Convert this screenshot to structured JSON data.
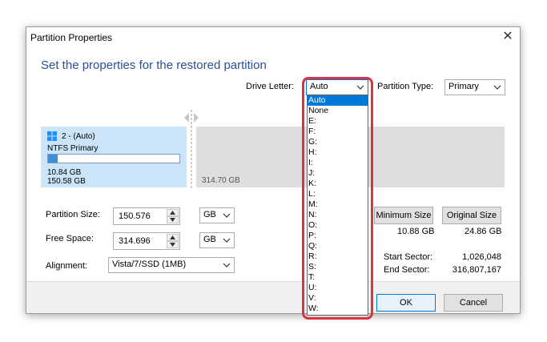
{
  "dialog": {
    "title": "Partition Properties",
    "heading": "Set the properties for the restored partition"
  },
  "drive_letter": {
    "label": "Drive Letter:",
    "value": "Auto"
  },
  "partition_type": {
    "label": "Partition Type:",
    "value": "Primary"
  },
  "partition_block": {
    "name": "2 - (Auto)",
    "fs": "NTFS Primary",
    "used": "10.84 GB",
    "total": "150.58 GB",
    "used_fraction": 0.072,
    "free_label": "314.70 GB"
  },
  "partition_size": {
    "label": "Partition Size:",
    "value": "150.576",
    "unit": "GB"
  },
  "free_space": {
    "label": "Free Space:",
    "value": "314.696",
    "unit": "GB"
  },
  "alignment": {
    "label": "Alignment:",
    "value": "Vista/7/SSD (1MB)"
  },
  "sizes": {
    "min_button": "Minimum Size",
    "orig_button": "Original Size",
    "min_value": "10.88 GB",
    "orig_value": "24.86 GB"
  },
  "sectors": {
    "start_label": "Start Sector:",
    "start_value": "1,026,048",
    "end_label": "End Sector:",
    "end_value": "316,807,167"
  },
  "buttons": {
    "ok": "OK",
    "cancel": "Cancel"
  },
  "dropdown_items": [
    "Auto",
    "None",
    "E:",
    "F:",
    "G:",
    "H:",
    "I:",
    "J:",
    "K:",
    "L:",
    "M:",
    "N:",
    "O:",
    "P:",
    "Q:",
    "R:",
    "S:",
    "T:",
    "U:",
    "V:",
    "W:"
  ],
  "colors": {
    "accent": "#0078d7",
    "highlight_border": "#d9353e",
    "heading": "#2a4f9b",
    "selected_partition": "#cce4f7",
    "usage_bar": "#3c8fd6"
  }
}
